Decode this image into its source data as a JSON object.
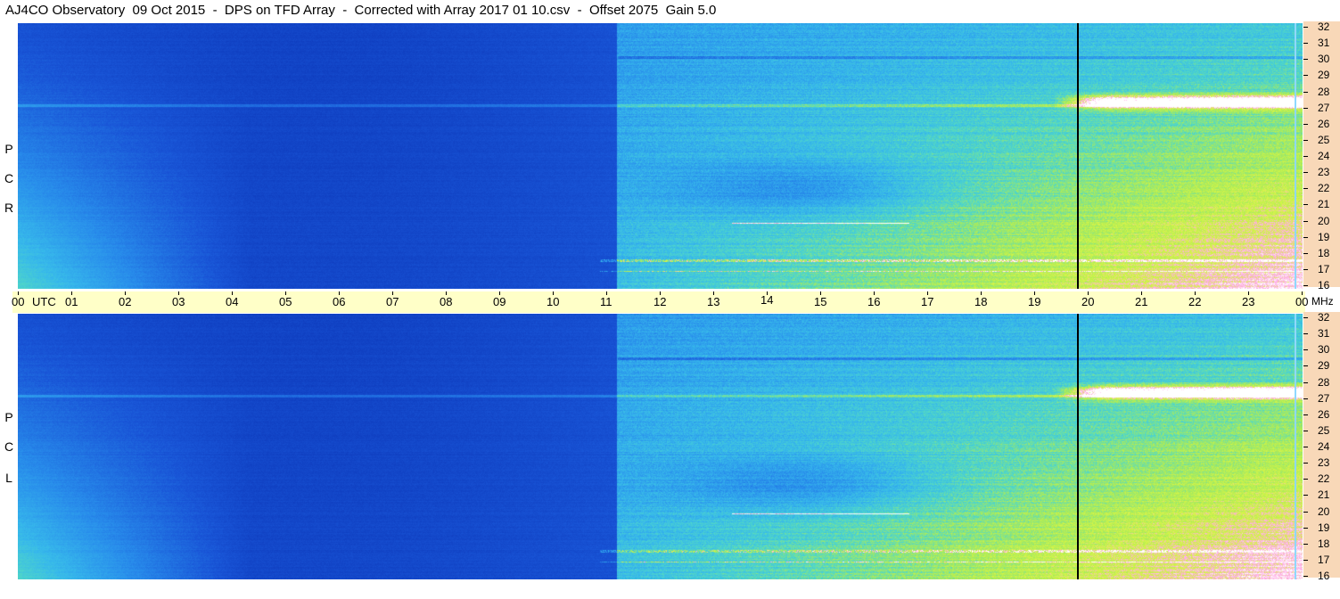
{
  "title": "AJ4CO Observatory  09 Oct 2015  -  DPS on TFD Array  -  Corrected with Array 2017 01 10.csv  -  Offset 2075  Gain 5.0",
  "panels": [
    {
      "id": "rcp",
      "letters": [
        "P",
        "C",
        "R"
      ]
    },
    {
      "id": "lcp",
      "letters": [
        "P",
        "C",
        "L"
      ]
    }
  ],
  "time_axis": {
    "unit_label": "UTC",
    "end_unit": "MHz",
    "ticks": [
      "00",
      "01",
      "02",
      "03",
      "04",
      "05",
      "06",
      "07",
      "08",
      "09",
      "10",
      "11",
      "12",
      "13",
      "14",
      "15",
      "16",
      "17",
      "18",
      "19",
      "20",
      "21",
      "22",
      "23",
      "00"
    ]
  },
  "freq_axis": {
    "ticks": [
      "32",
      "31",
      "30",
      "29",
      "28",
      "27",
      "26",
      "25",
      "24",
      "23",
      "22",
      "21",
      "20",
      "19",
      "18",
      "17",
      "16"
    ]
  },
  "chart_data": {
    "type": "heatmap",
    "title": "AJ4CO Observatory  09 Oct 2015  -  DPS on TFD Array  -  Corrected with Array 2017 01 10.csv  -  Offset 2075  Gain 5.0",
    "panels": [
      "RCP",
      "LCP"
    ],
    "x": {
      "label": "UTC",
      "range": [
        0,
        24
      ],
      "unit": "hours"
    },
    "y": {
      "label": "MHz",
      "range": [
        16,
        32
      ],
      "unit": "MHz"
    },
    "marker_time_utc": 19.8,
    "colormap": [
      "#0a3cc8",
      "#1e64e6",
      "#3ca0f0",
      "#50d2c8",
      "#c8f050",
      "#ffb4ff",
      "#ffffff"
    ],
    "notes_visible": [
      "strong emission near 27 MHz after 20 UTC",
      "noise bands near 17-18 MHz"
    ]
  }
}
